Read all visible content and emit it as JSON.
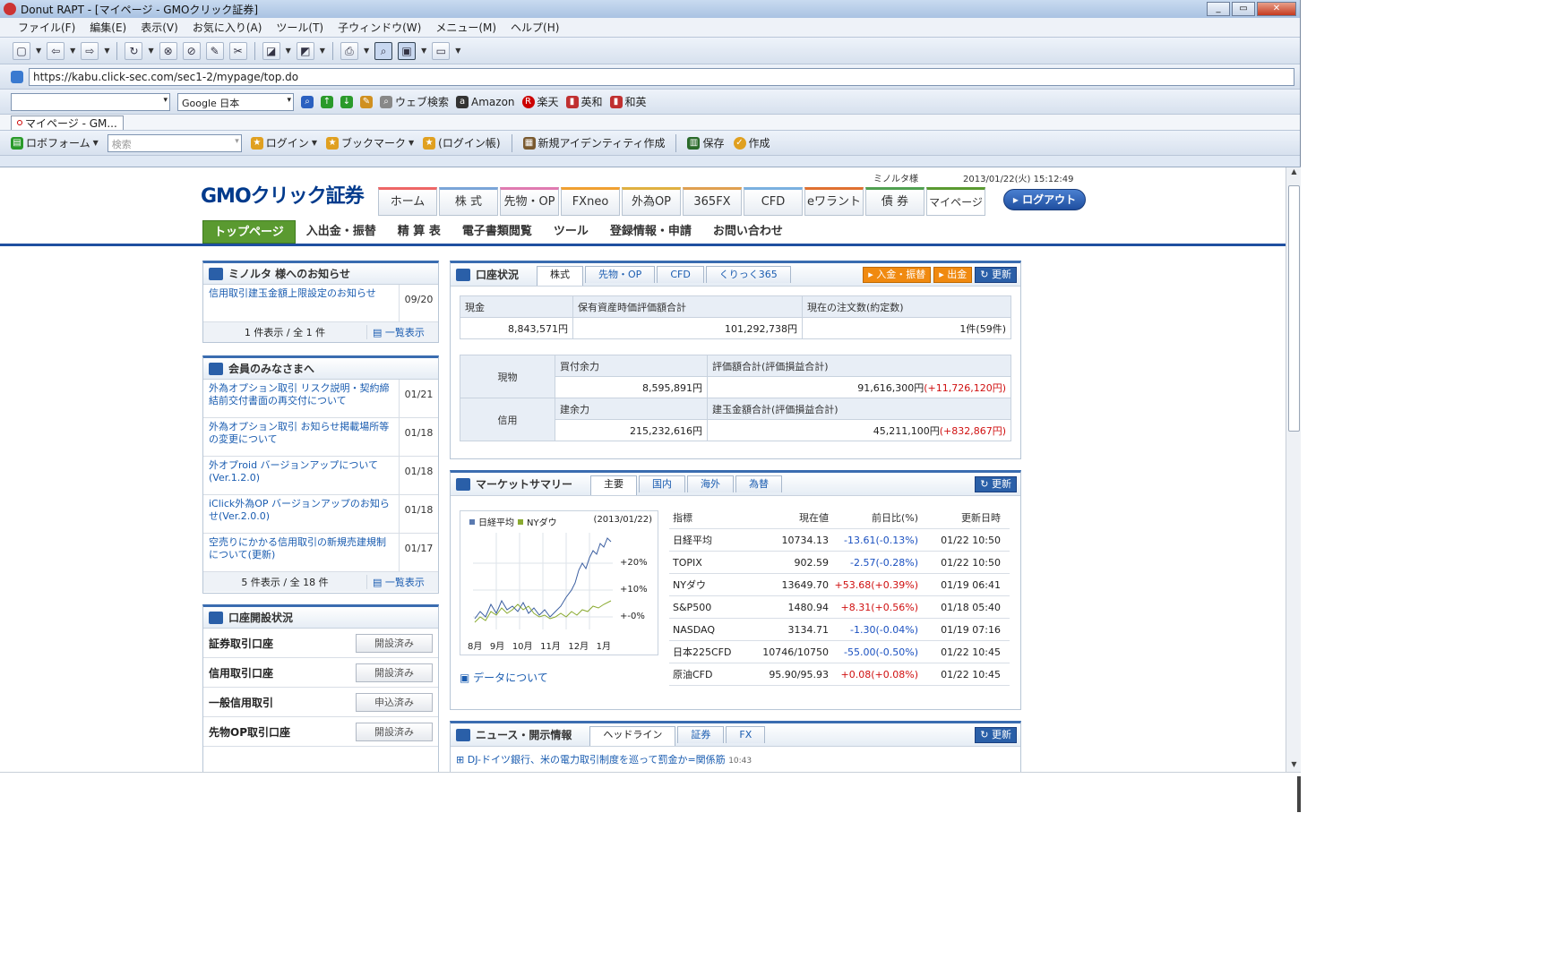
{
  "window": {
    "title": "Donut RAPT - [マイページ - GMOクリック証券]",
    "minimize": "_",
    "restore": "▭",
    "close": "✕"
  },
  "menu": [
    "ファイル(F)",
    "編集(E)",
    "表示(V)",
    "お気に入り(A)",
    "ツール(T)",
    "子ウィンドウ(W)",
    "メニュー(M)",
    "ヘルプ(H)"
  ],
  "address": {
    "url": "https://kabu.click-sec.com/sec1-2/mypage/top.do"
  },
  "searchbar": {
    "engine": "Google 日本",
    "links": [
      "ウェブ検索",
      "Amazon",
      "楽天",
      "英和",
      "和英"
    ]
  },
  "tabbar": {
    "tab1": "マイページ - GM..."
  },
  "favbar": {
    "roboform": "ロボフォーム",
    "search_placeholder": "検索",
    "login": "ログイン",
    "bookmark": "ブックマーク",
    "login_history": "(ログイン帳)",
    "new_identity": "新規アイデンティティ作成",
    "save": "保存",
    "create": "作成"
  },
  "site": {
    "logo": "GMOクリック証券",
    "user": "ミノルタ様",
    "datetime": "2013/01/22(火) 15:12:49",
    "gnav": [
      "ホーム",
      "株 式",
      "先物・OP",
      "FXneo",
      "外為OP",
      "365FX",
      "CFD",
      "eワラント",
      "債 券",
      "マイページ"
    ],
    "logout": "ログアウト",
    "subnav": [
      "トップページ",
      "入出金・振替",
      "精 算 表",
      "電子書類閲覧",
      "ツール",
      "登録情報・申請",
      "お問い合わせ"
    ]
  },
  "notice": {
    "title": "ミノルタ 様へのお知らせ",
    "items": [
      {
        "text": "信用取引建玉金額上限設定のお知らせ",
        "date": "09/20"
      }
    ],
    "count": "1 件表示 / 全 1 件",
    "list_link": "一覧表示"
  },
  "members": {
    "title": "会員のみなさまへ",
    "items": [
      {
        "text": "外為オプション取引 リスク説明・契約締結前交付書面の再交付について",
        "date": "01/21"
      },
      {
        "text": "外為オプション取引 お知らせ掲載場所等の変更について",
        "date": "01/18"
      },
      {
        "text": "外オプroid バージョンアップについて(Ver.1.2.0)",
        "date": "01/18"
      },
      {
        "text": "iClick外為OP バージョンアップのお知らせ(Ver.2.0.0)",
        "date": "01/18"
      },
      {
        "text": "空売りにかかる信用取引の新規売建規制について(更新)",
        "date": "01/17"
      }
    ],
    "count": "5 件表示 / 全 18 件",
    "list_link": "一覧表示"
  },
  "open_status": {
    "title": "口座開設状況",
    "rows": [
      {
        "label": "証券取引口座",
        "status": "開設済み"
      },
      {
        "label": "信用取引口座",
        "status": "開設済み"
      },
      {
        "label": "一般信用取引",
        "status": "申込済み"
      },
      {
        "label": "先物OP取引口座",
        "status": "開設済み"
      }
    ]
  },
  "account": {
    "title": "口座状況",
    "tabs": [
      "株式",
      "先物・OP",
      "CFD",
      "くりっく365"
    ],
    "btn_deposit": "入金・振替",
    "btn_withdraw": "出金",
    "btn_refresh": "更新",
    "hdr_cash": "現金",
    "hdr_assets": "保有資産時価評価額合計",
    "hdr_orders": "現在の注文数(約定数)",
    "cash": "8,843,571円",
    "assets": "101,292,738円",
    "orders": "1件(59件)",
    "spot_label": "現物",
    "spot_buy_hdr": "買付余力",
    "spot_val_hdr": "評価額合計(評価損益合計)",
    "spot_buy": "8,595,891円",
    "spot_val": "91,616,300円",
    "spot_pl": "(+11,726,120円)",
    "margin_label": "信用",
    "margin_buy_hdr": "建余力",
    "margin_val_hdr": "建玉金額合計(評価損益合計)",
    "margin_buy": "215,232,616円",
    "margin_val": "45,211,100円",
    "margin_pl": "(+832,867円)"
  },
  "market": {
    "title": "マーケットサマリー",
    "tabs": [
      "主要",
      "国内",
      "海外",
      "為替"
    ],
    "btn_refresh": "更新",
    "chart_legend1": "日経平均",
    "chart_legend2": "NYダウ",
    "chart_date": "(2013/01/22)",
    "chart_y": [
      "+20%",
      "+10%",
      "+-0%"
    ],
    "chart_x": [
      "8月",
      "9月",
      "10月",
      "11月",
      "12月",
      "1月"
    ],
    "data_link": "データについて",
    "headers": [
      "指標",
      "現在値",
      "前日比(%)",
      "更新日時"
    ],
    "rows": [
      {
        "name": "日経平均",
        "value": "10734.13",
        "change": "-13.61(-0.13%)",
        "time": "01/22 10:50",
        "up": false
      },
      {
        "name": "TOPIX",
        "value": "902.59",
        "change": "-2.57(-0.28%)",
        "time": "01/22 10:50",
        "up": false
      },
      {
        "name": "NYダウ",
        "value": "13649.70",
        "change": "+53.68(+0.39%)",
        "time": "01/19 06:41",
        "up": true
      },
      {
        "name": "S&P500",
        "value": "1480.94",
        "change": "+8.31(+0.56%)",
        "time": "01/18 05:40",
        "up": true
      },
      {
        "name": "NASDAQ",
        "value": "3134.71",
        "change": "-1.30(-0.04%)",
        "time": "01/19 07:16",
        "up": false
      },
      {
        "name": "日本225CFD",
        "value": "10746/10750",
        "change": "-55.00(-0.50%)",
        "time": "01/22 10:45",
        "up": false
      },
      {
        "name": "原油CFD",
        "value": "95.90/95.93",
        "change": "+0.08(+0.08%)",
        "time": "01/22 10:45",
        "up": true
      }
    ]
  },
  "news": {
    "title": "ニュース・開示情報",
    "tabs": [
      "ヘッドライン",
      "証券",
      "FX"
    ],
    "btn_refresh": "更新",
    "item1": "DJ-ドイツ銀行、米の電力取引制度を巡って罰金か=関係筋",
    "item1_time": "10:43"
  },
  "colors": {
    "accent": "#1f4fa0",
    "active_green": "#5a9a30",
    "red": "#d01010",
    "blue": "#1a50c0"
  }
}
